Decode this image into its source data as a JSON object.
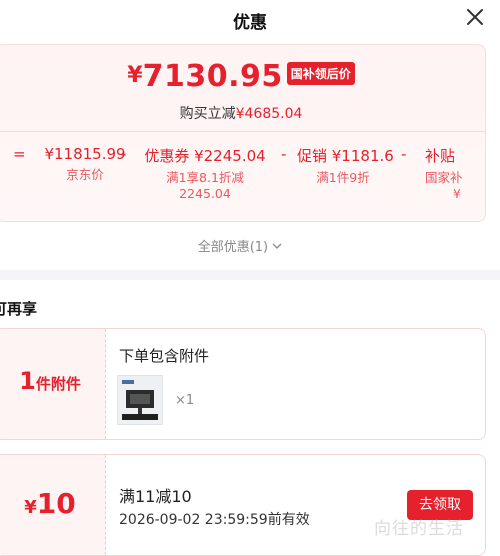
{
  "header": {
    "title": "优惠"
  },
  "price": {
    "currency": "¥",
    "amount": "7130.95",
    "tag": "国补领后价",
    "reduce_label": "购买立减",
    "reduce_amount": "¥4685.04"
  },
  "formula": {
    "eq": "=",
    "jd_price": "¥11815.99",
    "jd_label": "京东价",
    "minus1": "-",
    "coupon_main": "优惠券 ¥2245.04",
    "coupon_sub1": "满1享8.1折减",
    "coupon_sub2": "2245.04",
    "minus2": "-",
    "promo_main": "促销 ¥1181.6",
    "promo_sub": "满1件9折",
    "minus3": "-",
    "subsidy_main": "补贴",
    "subsidy_sub1": "国家补",
    "subsidy_sub2": "¥"
  },
  "all_discounts": "全部优惠(1)",
  "section": {
    "title": "可再享"
  },
  "coupon_accessory": {
    "big_num": "1",
    "big_unit": "件附件",
    "title": "下单包含附件",
    "qty": "×1"
  },
  "coupon_cash": {
    "currency": "¥",
    "amount": "10",
    "title": "满11减10",
    "expiry": "2026-09-02 23:59:59前有效",
    "button": "去领取"
  },
  "watermark": "向往的生活",
  "colors": {
    "accent": "#e4212c",
    "card_bg": "#fff4f4"
  }
}
